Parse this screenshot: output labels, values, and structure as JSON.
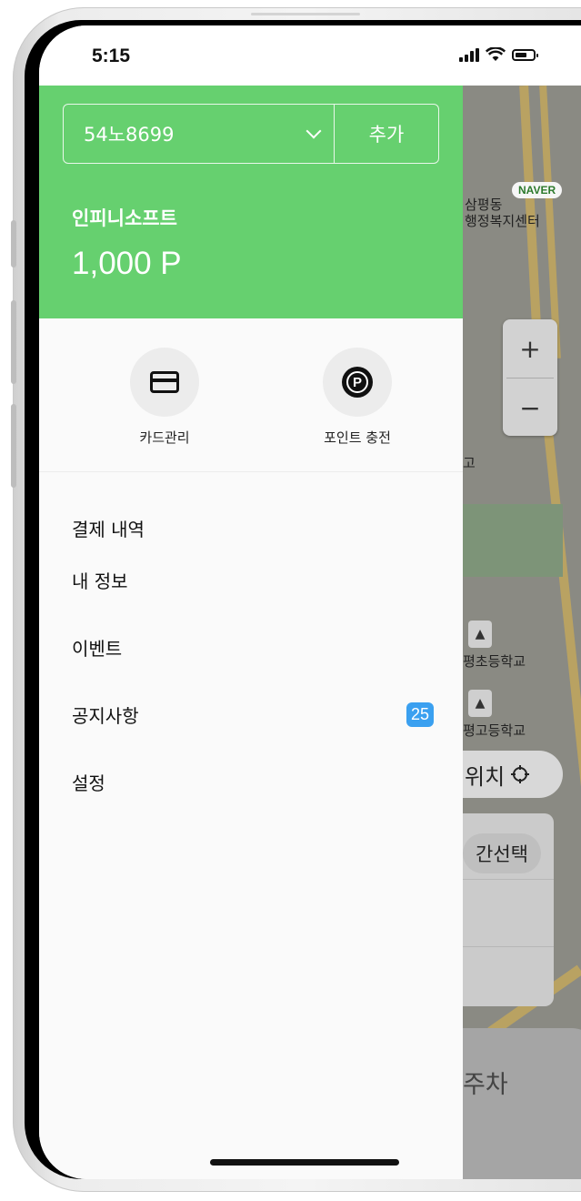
{
  "status_bar": {
    "time": "5:15"
  },
  "drawer": {
    "vehicle_plate": "54노8699",
    "add_button": "추가",
    "company_name": "인피니소프트",
    "points": "1,000 P",
    "quick_actions": [
      {
        "label": "카드관리",
        "icon": "credit-card-icon"
      },
      {
        "label": "포인트 충전",
        "icon": "point-icon"
      }
    ],
    "menu_items": [
      {
        "label": "결제 내역"
      },
      {
        "label": "내 정보"
      },
      {
        "label": "이벤트"
      },
      {
        "label": "공지사항",
        "badge": "25"
      },
      {
        "label": "설정"
      }
    ]
  },
  "map": {
    "provider_badge": "NAVER",
    "label_samp": "삼평동",
    "label_center": "행정복지센터",
    "label_school1": "평초등학교",
    "label_school2": "평고등학교",
    "label_partial": "고",
    "zoom_in": "+",
    "zoom_out": "−",
    "location_button": "위치",
    "time_select_chip": "간선택",
    "parking_button": "주차"
  },
  "colors": {
    "header_green": "#66d06f",
    "badge_blue": "#3aa0f0"
  }
}
